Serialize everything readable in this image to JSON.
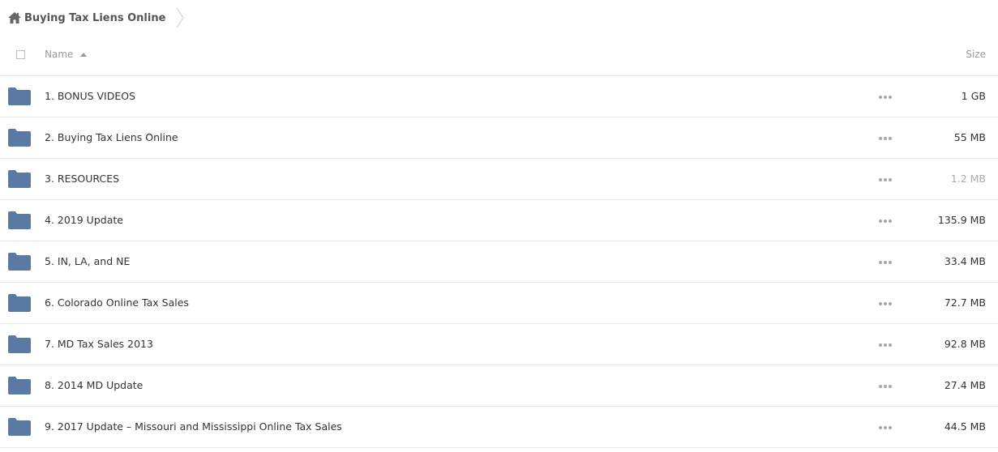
{
  "breadcrumb": {
    "home_icon": "home-icon",
    "label": "Buying Tax Liens Online"
  },
  "header": {
    "name_label": "Name",
    "size_label": "Size",
    "sort": "ascending"
  },
  "colors": {
    "folder": "#5a79a3",
    "divider": "#e6e6e6",
    "muted_text": "#999999"
  },
  "rows": [
    {
      "name": "1. BONUS VIDEOS",
      "size": "1 GB",
      "icon": "folder-icon"
    },
    {
      "name": "2. Buying Tax Liens Online",
      "size": "55 MB",
      "icon": "folder-icon"
    },
    {
      "name": "3. RESOURCES",
      "size": "1.2 MB",
      "icon": "folder-icon"
    },
    {
      "name": "4. 2019 Update",
      "size": "135.9 MB",
      "icon": "folder-icon"
    },
    {
      "name": "5. IN, LA, and NE",
      "size": "33.4 MB",
      "icon": "folder-icon"
    },
    {
      "name": "6. Colorado Online Tax Sales",
      "size": "72.7 MB",
      "icon": "folder-icon"
    },
    {
      "name": "7. MD Tax Sales 2013",
      "size": "92.8 MB",
      "icon": "folder-icon"
    },
    {
      "name": "8. 2014 MD Update",
      "size": "27.4 MB",
      "icon": "folder-icon"
    },
    {
      "name": "9. 2017 Update – Missouri and Mississippi Online Tax Sales",
      "size": "44.5 MB",
      "icon": "folder-icon"
    }
  ]
}
